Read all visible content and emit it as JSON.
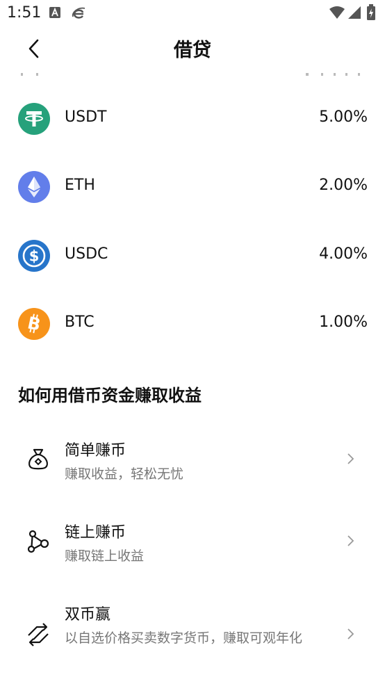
{
  "status_bar": {
    "time": "1:51"
  },
  "header": {
    "title": "借贷"
  },
  "coins": [
    {
      "name": "USDT",
      "rate": "5.00%",
      "icon": "usdt-icon",
      "color": "#26A17B"
    },
    {
      "name": "ETH",
      "rate": "2.00%",
      "icon": "eth-icon",
      "color": "#627EEA"
    },
    {
      "name": "USDC",
      "rate": "4.00%",
      "icon": "usdc-icon",
      "color": "#2775CA"
    },
    {
      "name": "BTC",
      "rate": "1.00%",
      "icon": "btc-icon",
      "color": "#F7931A"
    }
  ],
  "section": {
    "title": "如何用借币资金赚取收益"
  },
  "earn_options": [
    {
      "title": "简单赚币",
      "desc": "赚取收益，轻松无忧",
      "icon": "money-bag-icon"
    },
    {
      "title": "链上赚币",
      "desc": "赚取链上收益",
      "icon": "chain-nodes-icon"
    },
    {
      "title": "双币赢",
      "desc": "以自选价格买卖数字货币，赚取可观年化",
      "icon": "dual-arrows-icon"
    }
  ]
}
